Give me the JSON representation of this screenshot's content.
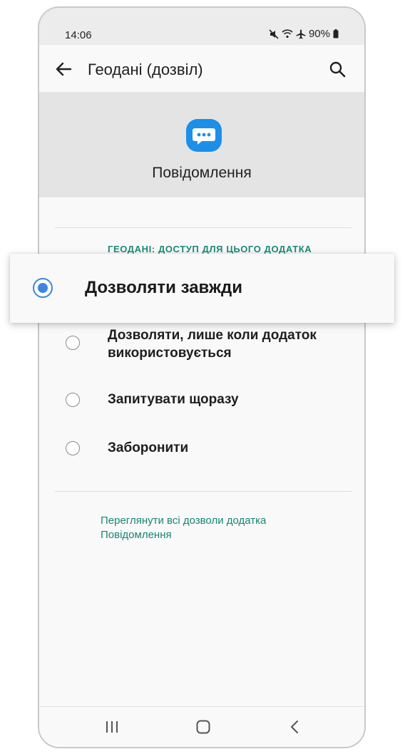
{
  "status_bar": {
    "time": "14:06",
    "battery": "90%",
    "icons": [
      "mute-icon",
      "wifi-icon",
      "airplane-icon",
      "battery-icon"
    ]
  },
  "app_bar": {
    "title": "Геодані (дозвіл)",
    "back_icon": "back-arrow-icon",
    "search_icon": "search-icon"
  },
  "app": {
    "name": "Повідомлення",
    "icon": "messages-icon",
    "icon_color": "#1d8fe8"
  },
  "permission": {
    "section_header": "ГЕОДАНІ: ДОСТУП ДЛЯ ЦЬОГО ДОДАТКА",
    "options": [
      {
        "label": "Дозволяти завжди",
        "selected": true
      },
      {
        "label": "Дозволяти, лише коли додаток використовується",
        "selected": false
      },
      {
        "label": "Запитувати щоразу",
        "selected": false
      },
      {
        "label": "Заборонити",
        "selected": false
      }
    ]
  },
  "link": {
    "text": "Переглянути всі дозволи додатка Повідомлення"
  },
  "nav_bar": {
    "icons": [
      "recents-icon",
      "home-icon",
      "back-icon"
    ]
  },
  "colors": {
    "accent_teal": "#1b8a78",
    "radio_selected": "#3d86dd"
  }
}
